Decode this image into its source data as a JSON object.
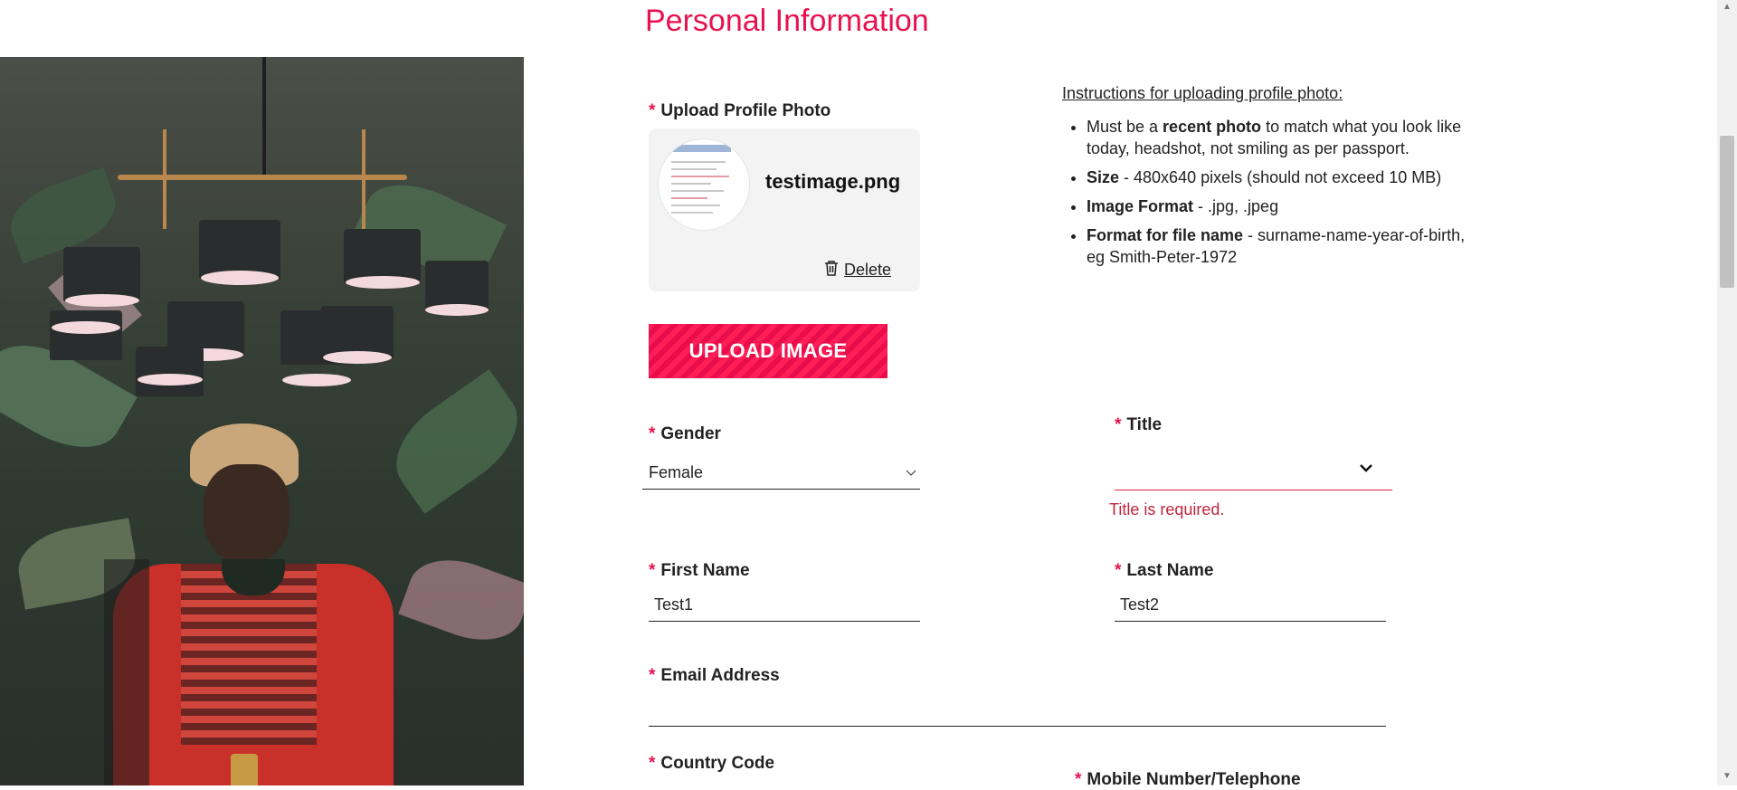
{
  "page": {
    "section_title": "Personal Information"
  },
  "upload": {
    "label": "Upload Profile Photo",
    "filename": "testimage.png",
    "delete_label": "Delete",
    "button_label": "UPLOAD IMAGE"
  },
  "instructions": {
    "title": "Instructions for uploading profile photo:",
    "items": [
      {
        "bold": "recent photo",
        "pre": "Must be a ",
        "post": " to match what you look like today, headshot, not smiling as per passport."
      },
      {
        "bold": "Size",
        "pre": "",
        "post": " - 480x640 pixels (should not exceed 10 MB)"
      },
      {
        "bold": "Image Format",
        "pre": "",
        "post": " - .jpg, .jpeg"
      },
      {
        "bold": "Format for file name",
        "pre": "",
        "post": " - surname-name-year-of-birth, eg Smith-Peter-1972"
      }
    ]
  },
  "form": {
    "required_mark": "*",
    "gender": {
      "label": "Gender",
      "value": "Female"
    },
    "title": {
      "label": "Title",
      "value": "",
      "error": "Title is required."
    },
    "first_name": {
      "label": "First Name",
      "value": "Test1"
    },
    "last_name": {
      "label": "Last Name",
      "value": "Test2"
    },
    "email": {
      "label": "Email Address",
      "value": ""
    },
    "country_code": {
      "label": "Country Code"
    },
    "mobile": {
      "label": "Mobile Number/Telephone"
    }
  },
  "icons": {
    "delete": "trash-icon",
    "select_gender": "chevron-down-icon",
    "select_title": "chevron-down-icon"
  },
  "colors": {
    "accent": "#e8124f",
    "error": "#c0253e"
  }
}
